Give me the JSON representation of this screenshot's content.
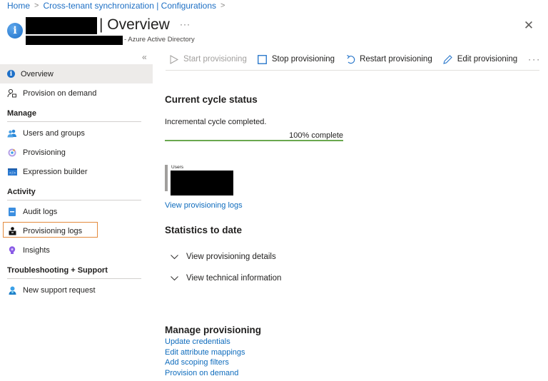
{
  "breadcrumb": [
    {
      "label": "Home"
    },
    {
      "label": "Cross-tenant synchronization | Configurations"
    }
  ],
  "header": {
    "title": "| Overview",
    "subtitle": "- Azure Active Directory",
    "more_label": "···",
    "close_label": "✕",
    "collapse_label": "«"
  },
  "sidebar": {
    "top_items": [
      {
        "label": "Overview",
        "icon": "info-icon",
        "active": true
      },
      {
        "label": "Provision on demand",
        "icon": "user-sync-icon"
      }
    ],
    "sections": [
      {
        "title": "Manage",
        "items": [
          {
            "label": "Users and groups",
            "icon": "users-icon"
          },
          {
            "label": "Provisioning",
            "icon": "provisioning-icon"
          },
          {
            "label": "Expression builder",
            "icon": "code-icon"
          }
        ]
      },
      {
        "title": "Activity",
        "items": [
          {
            "label": "Audit logs",
            "icon": "audit-log-icon"
          },
          {
            "label": "Provisioning logs",
            "icon": "provisioning-log-icon",
            "highlighted": true
          },
          {
            "label": "Insights",
            "icon": "lightbulb-icon"
          }
        ]
      },
      {
        "title": "Troubleshooting + Support",
        "items": [
          {
            "label": "New support request",
            "icon": "support-icon"
          }
        ]
      }
    ]
  },
  "toolbar": {
    "start": "Start provisioning",
    "stop": "Stop provisioning",
    "restart": "Restart provisioning",
    "edit": "Edit provisioning",
    "more": "···"
  },
  "cycle": {
    "heading": "Current cycle status",
    "status": "Incremental cycle completed.",
    "progress_percent": 100,
    "progress_label": "100% complete",
    "users_label": "Users",
    "view_logs": "View provisioning logs",
    "colors": {
      "progress": "#6aa84f"
    }
  },
  "statistics": {
    "heading": "Statistics to date",
    "expanders": [
      "View provisioning details",
      "View technical information"
    ]
  },
  "manage_provisioning": {
    "heading": "Manage provisioning",
    "links": [
      "Update credentials",
      "Edit attribute mappings",
      "Add scoping filters",
      "Provision on demand"
    ]
  }
}
